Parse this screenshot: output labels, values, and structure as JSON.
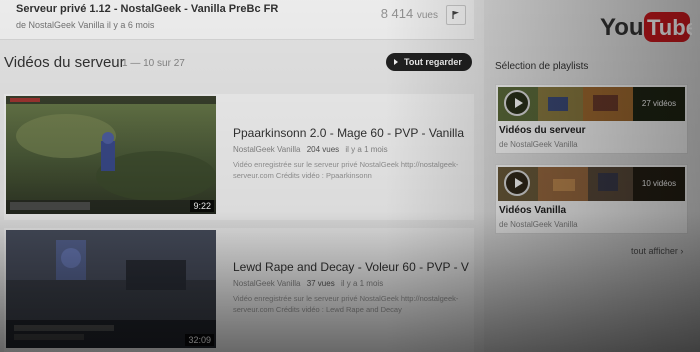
{
  "top_video": {
    "title": "Serveur privé 1.12 - NostalGeek - Vanilla PreBc FR",
    "meta": "de NostalGeek Vanilla il y a 6 mois",
    "views_count": "8 414",
    "views_unit": "vues",
    "flag_icon": "flag-icon"
  },
  "section": {
    "title": "Vidéos du serveur",
    "count": "1 — 10 sur 27",
    "watch_all_label": "Tout regarder"
  },
  "videos": [
    {
      "title": "Ppaarkinsonn 2.0 - Mage 60 - PVP - Vanilla",
      "channel": "NostalGeek Vanilla",
      "views": "204 vues",
      "age": "il y a 1 mois",
      "description": "Vidéo enregistrée sur le serveur privé NostalGeek http://nostalgeek-serveur.com Crédits vidéo : Ppaarkinsonn",
      "duration": "9:22"
    },
    {
      "title": "Lewd Rape and Decay - Voleur 60 - PVP - V",
      "channel": "NostalGeek Vanilla",
      "views": "37 vues",
      "age": "il y a 1 mois",
      "description": "Vidéo enregistrée sur le serveur privé NostalGeek http://nostalgeek-serveur.com Crédits vidéo : Lewd Rape and Decay",
      "duration": "32:09"
    }
  ],
  "sidebar": {
    "logo_you": "You",
    "logo_tube": "Tube",
    "heading": "Sélection de playlists",
    "playlists": [
      {
        "title": "Vidéos du serveur",
        "by": "de NostalGeek Vanilla",
        "count": "27 vidéos"
      },
      {
        "title": "Vidéos Vanilla",
        "by": "de NostalGeek Vanilla",
        "count": "10 vidéos"
      }
    ],
    "see_all": "tout afficher ›"
  },
  "colors": {
    "logo_red": "#cc181e",
    "dark_button": "#222222"
  }
}
